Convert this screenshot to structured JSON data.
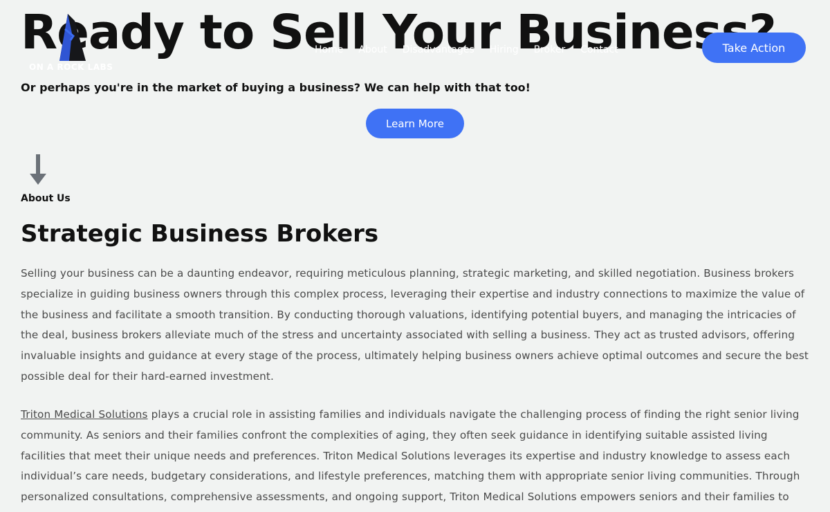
{
  "header": {
    "logo_text": "ON A ROCK LABS",
    "nav": [
      "Home",
      "About",
      "Disadvantages",
      "Hiring",
      "Broker",
      "Contact"
    ],
    "cta_label": "Take Action"
  },
  "hero": {
    "title": "Ready to Sell Your Business?",
    "subtitle": "Or perhaps you're in the market of buying a business? We can help with that too!",
    "button_label": "Learn More"
  },
  "about": {
    "label": "About Us",
    "title": "Strategic Business Brokers",
    "paragraph1": "Selling your business can be a daunting endeavor, requiring meticulous planning, strategic marketing, and skilled negotiation. Business brokers specialize in guiding business owners through this complex process, leveraging their expertise and industry connections to maximize the value of the business and facilitate a smooth transition. By conducting thorough valuations, identifying potential buyers, and managing the intricacies of the deal, business brokers alleviate much of the stress and uncertainty associated with selling a business. They act as trusted advisors, offering invaluable insights and guidance at every stage of the process, ultimately helping business owners achieve optimal outcomes and secure the best possible deal for their hard-earned investment.",
    "paragraph2_link": "Triton Medical Solutions",
    "paragraph2_rest": " plays a crucial role in assisting families and individuals navigate the challenging process of finding the right senior living community. As seniors and their families confront the complexities of aging, they often seek guidance in identifying suitable assisted living facilities that meet their unique needs and preferences. Triton Medical Solutions leverages its expertise and industry knowledge to assess each individual’s care needs, budgetary considerations, and lifestyle preferences, matching them with appropriate senior living communities. Through personalized consultations, comprehensive assessments, and ongoing support, Triton Medical Solutions empowers seniors and their families to"
  },
  "colors": {
    "background": "#f1f3f2",
    "accent": "#3f72f5",
    "arrow": "#6b7178",
    "logo_blue": "#2f55d4"
  },
  "icons": [
    "logo-icon",
    "arrow-down-icon"
  ]
}
